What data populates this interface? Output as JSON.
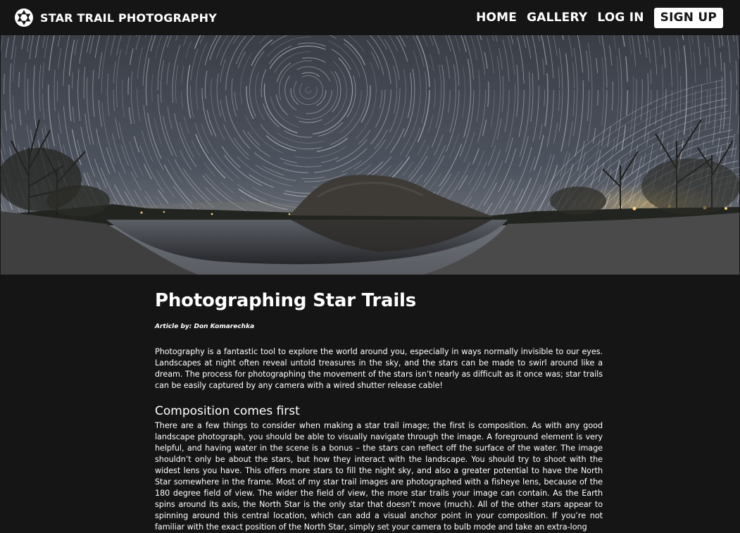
{
  "header": {
    "brand_title": "STAR TRAIL PHOTOGRAPHY",
    "logo_icon": "camera-aperture-icon",
    "nav": {
      "home": "HOME",
      "gallery": "GALLERY",
      "login": "LOG IN",
      "signup": "SIGN UP"
    }
  },
  "hero": {
    "description_icon": "star-trail-landscape-image"
  },
  "article": {
    "title": "Photographing Star Trails",
    "byline": "Article by: Don Komarechka",
    "intro": "Photography is a fantastic tool to explore the world around you, especially in ways normally invisible to our eyes. Landscapes at night often reveal untold treasures in the sky, and the stars can be made to swirl around like a dream. The process for photographing the movement of the stars isn’t nearly as difficult as it once was; star trails can be easily captured by any camera with a wired shutter release cable!",
    "section_heading": "Composition comes first",
    "section_body": "There are a few things to consider when making a star trail image; the first is composition. As with any good landscape photograph, you should be able to visually navigate through the image. A foreground element is very helpful, and having water in the scene is a bonus – the stars can reflect off the surface of the water. The image shouldn’t only be about the stars, but how they interact with the landscape. You should try to shoot with the widest lens you have. This offers more stars to fill the night sky, and also a greater potential to have the North Star somewhere in the frame. Most of my star trail images are photographed with a fisheye lens, because of the 180 degree field of view. The wider the field of view, the more star trails your image can contain. As the Earth spins around its axis, the North Star is the only star that doesn’t move (much). All of the other stars appear to spinning around this central location, which can add a visual anchor point in your composition. If you’re not familiar with the exact position of the North Star, simply set your camera to bulb mode and take an extra-long"
  },
  "colors": {
    "page_background": "#151515",
    "text": "#ffffff",
    "signup_background": "#ffffff",
    "signup_text": "#151515"
  }
}
